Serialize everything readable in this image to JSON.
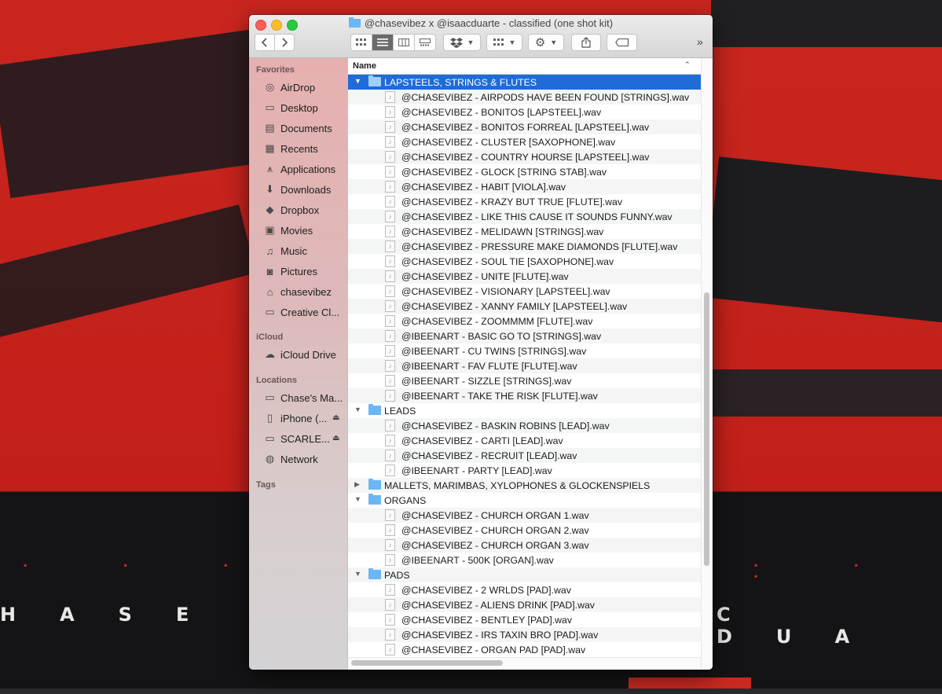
{
  "window": {
    "title": "@chasevibez x @isaacduarte - classified (one shot kit)"
  },
  "toolbar": {
    "back_icon": "chevron-left-icon",
    "forward_icon": "chevron-right-icon",
    "view_icons": [
      "icon-view-icon",
      "list-view-icon",
      "column-view-icon",
      "gallery-view-icon"
    ],
    "active_view": "list-view-icon",
    "overflow": "»"
  },
  "sidebar": {
    "favorites_header": "Favorites",
    "favorites": [
      {
        "label": "AirDrop",
        "icon": "airdrop-icon"
      },
      {
        "label": "Desktop",
        "icon": "desktop-icon"
      },
      {
        "label": "Documents",
        "icon": "documents-icon"
      },
      {
        "label": "Recents",
        "icon": "recents-icon"
      },
      {
        "label": "Applications",
        "icon": "applications-icon"
      },
      {
        "label": "Downloads",
        "icon": "downloads-icon"
      },
      {
        "label": "Dropbox",
        "icon": "dropbox-icon"
      },
      {
        "label": "Movies",
        "icon": "movies-icon"
      },
      {
        "label": "Music",
        "icon": "music-icon"
      },
      {
        "label": "Pictures",
        "icon": "pictures-icon"
      },
      {
        "label": "chasevibez",
        "icon": "home-icon"
      },
      {
        "label": "Creative Cl...",
        "icon": "folder-icon"
      }
    ],
    "icloud_header": "iCloud",
    "icloud": [
      {
        "label": "iCloud Drive",
        "icon": "icloud-icon"
      }
    ],
    "locations_header": "Locations",
    "locations": [
      {
        "label": "Chase's Ma...",
        "icon": "laptop-icon"
      },
      {
        "label": "iPhone (...",
        "icon": "iphone-icon"
      },
      {
        "label": "SCARLE...",
        "icon": "drive-icon"
      },
      {
        "label": "Network",
        "icon": "network-icon"
      }
    ],
    "tags_header": "Tags"
  },
  "list": {
    "column_name": "Name",
    "rows": [
      {
        "kind": "folder",
        "name": "LAPSTEELS, STRINGS & FLUTES",
        "expanded": true,
        "selected": true
      },
      {
        "kind": "file",
        "name": "@CHASEVIBEZ - AIRPODS HAVE BEEN FOUND [STRINGS].wav"
      },
      {
        "kind": "file",
        "name": "@CHASEVIBEZ - BONITOS [LAPSTEEL].wav"
      },
      {
        "kind": "file",
        "name": "@CHASEVIBEZ - BONITOS FORREAL [LAPSTEEL].wav"
      },
      {
        "kind": "file",
        "name": "@CHASEVIBEZ - CLUSTER [SAXOPHONE].wav"
      },
      {
        "kind": "file",
        "name": "@CHASEVIBEZ - COUNTRY HOURSE [LAPSTEEL].wav"
      },
      {
        "kind": "file",
        "name": "@CHASEVIBEZ - GLOCK [STRING STAB].wav"
      },
      {
        "kind": "file",
        "name": "@CHASEVIBEZ - HABIT [VIOLA].wav"
      },
      {
        "kind": "file",
        "name": "@CHASEVIBEZ - KRAZY BUT TRUE [FLUTE].wav"
      },
      {
        "kind": "file",
        "name": "@CHASEVIBEZ - LIKE THIS CAUSE IT SOUNDS FUNNY.wav"
      },
      {
        "kind": "file",
        "name": "@CHASEVIBEZ - MELIDAWN [STRINGS].wav"
      },
      {
        "kind": "file",
        "name": "@CHASEVIBEZ - PRESSURE MAKE DIAMONDS [FLUTE].wav"
      },
      {
        "kind": "file",
        "name": "@CHASEVIBEZ - SOUL TIE [SAXOPHONE].wav"
      },
      {
        "kind": "file",
        "name": "@CHASEVIBEZ - UNITE [FLUTE].wav"
      },
      {
        "kind": "file",
        "name": "@CHASEVIBEZ - VISIONARY [LAPSTEEL].wav"
      },
      {
        "kind": "file",
        "name": "@CHASEVIBEZ - XANNY FAMILY [LAPSTEEL].wav"
      },
      {
        "kind": "file",
        "name": "@CHASEVIBEZ - ZOOMMMM [FLUTE].wav"
      },
      {
        "kind": "file",
        "name": "@IBEENART - BASIC GO TO [STRINGS].wav"
      },
      {
        "kind": "file",
        "name": "@IBEENART - CU TWINS [STRINGS].wav"
      },
      {
        "kind": "file",
        "name": "@IBEENART - FAV FLUTE [FLUTE].wav"
      },
      {
        "kind": "file",
        "name": "@IBEENART - SIZZLE [STRINGS].wav"
      },
      {
        "kind": "file",
        "name": "@IBEENART - TAKE THE RISK [FLUTE].wav"
      },
      {
        "kind": "folder",
        "name": "LEADS",
        "expanded": true
      },
      {
        "kind": "file",
        "name": "@CHASEVIBEZ - BASKIN ROBINS [LEAD].wav"
      },
      {
        "kind": "file",
        "name": "@CHASEVIBEZ - CARTI [LEAD].wav"
      },
      {
        "kind": "file",
        "name": "@CHASEVIBEZ - RECRUIT [LEAD].wav"
      },
      {
        "kind": "file",
        "name": "@IBEENART - PARTY [LEAD].wav"
      },
      {
        "kind": "folder",
        "name": "MALLETS, MARIMBAS, XYLOPHONES & GLOCKENSPIELS",
        "expanded": false
      },
      {
        "kind": "folder",
        "name": "ORGANS",
        "expanded": true
      },
      {
        "kind": "file",
        "name": "@CHASEVIBEZ - CHURCH ORGAN 1.wav"
      },
      {
        "kind": "file",
        "name": "@CHASEVIBEZ - CHURCH ORGAN 2.wav"
      },
      {
        "kind": "file",
        "name": "@CHASEVIBEZ - CHURCH ORGAN 3.wav"
      },
      {
        "kind": "file",
        "name": "@IBEENART - 500K [ORGAN].wav"
      },
      {
        "kind": "folder",
        "name": "PADS",
        "expanded": true
      },
      {
        "kind": "file",
        "name": "@CHASEVIBEZ - 2 WRLDS [PAD].wav"
      },
      {
        "kind": "file",
        "name": "@CHASEVIBEZ - ALIENS DRINK [PAD].wav"
      },
      {
        "kind": "file",
        "name": "@CHASEVIBEZ - BENTLEY [PAD].wav"
      },
      {
        "kind": "file",
        "name": "@CHASEVIBEZ - IRS TAXIN BRO [PAD].wav"
      },
      {
        "kind": "file",
        "name": "@CHASEVIBEZ - ORGAN PAD [PAD].wav"
      }
    ]
  },
  "wallpaper": {
    "big_left": "HASE V",
    "big_right": "C DUA"
  },
  "colors": {
    "selection": "#1f6cd6",
    "folder": "#6bb6f5",
    "wallpaper_red": "#c8261e"
  }
}
